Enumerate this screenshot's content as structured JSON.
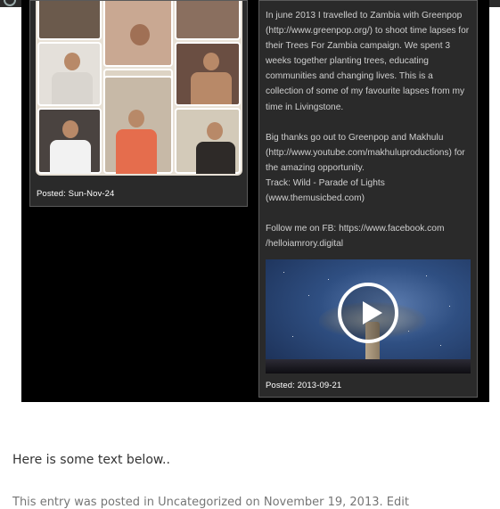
{
  "left_card": {
    "posted": "Posted: Sun-Nov-24"
  },
  "right_card": {
    "paragraphs": [
      "In june 2013 I travelled to Zambia with Greenpop (http://www.greenpop.org/) to shoot time lapses for their Trees For Zambia campaign. We spent 3 weeks together planting trees, educating communities and changing lives. This is a collection of some of my favourite lapses from my time in Livingstone.",
      "Big thanks go out to Greenpop and Makhulu (http://www.youtube.com/makhuluproductions) for the amazing opportunity.\nTrack: Wild - Parade of Lights (www.themusicbed.com)",
      "Follow me on FB: https://www.facebook.com /helloiamrory.digital"
    ],
    "posted": "Posted: 2013-09-21"
  },
  "content": {
    "text": "Here is some text below.."
  },
  "entry_meta": {
    "prefix": "This entry was posted in",
    "category": "Uncategorized",
    "on": "on",
    "date": "November 19, 2013",
    "edit": "Edit"
  },
  "icons": {
    "admin_logo": "wordpress-icon",
    "play": "play-icon"
  },
  "colors": {
    "embed_bg": "#000000",
    "card_bg": "#2a2a2a",
    "text_muted": "#767676"
  }
}
